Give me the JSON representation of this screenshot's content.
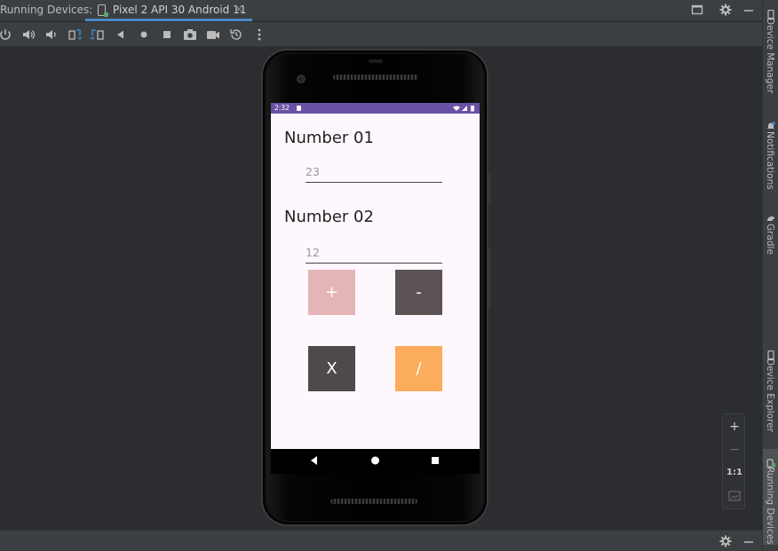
{
  "header": {
    "title": "Running Devices:",
    "tab_label": "Pixel 2 API 30 Android 11",
    "tab_close": "×"
  },
  "toolbar": {
    "icons": [
      "power-icon",
      "volume-up-icon",
      "volume-down-icon",
      "rotate-left-icon",
      "rotate-right-icon",
      "back-icon",
      "home-icon",
      "overview-icon",
      "screenshot-icon",
      "screen-record-icon",
      "reset-icon",
      "more-icon"
    ]
  },
  "sidebar": {
    "items": [
      {
        "label": "Device Manager"
      },
      {
        "label": "Notifications"
      },
      {
        "label": "Gradle"
      },
      {
        "label": "Device Explorer"
      },
      {
        "label": "Running Devices"
      }
    ]
  },
  "zoom": {
    "zoom_in": "+",
    "zoom_out": "−",
    "actual": "1:1"
  },
  "device": {
    "status_time": "2:32",
    "number1_label": "Number 01",
    "number1_value": "23",
    "number2_label": "Number 02",
    "number2_value": "12",
    "btn_add": "+",
    "btn_sub": "-",
    "btn_mul": "X",
    "btn_div": "/",
    "colors": {
      "status_bar": "#6951a6",
      "btn_add": "#e4b5b6",
      "btn_sub": "#5a5253",
      "btn_mul": "#4f4949",
      "btn_div": "#fbac5c"
    }
  }
}
